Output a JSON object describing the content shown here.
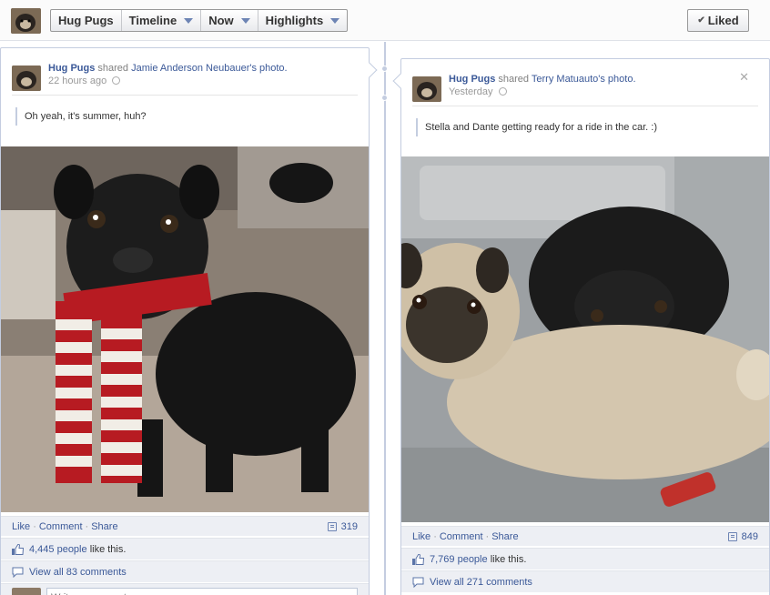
{
  "topbar": {
    "page_avatar": "hug-pugs-avatar",
    "nav": [
      {
        "label": "Hug Pugs",
        "caret": false
      },
      {
        "label": "Timeline",
        "caret": true
      },
      {
        "label": "Now",
        "caret": true
      },
      {
        "label": "Highlights",
        "caret": true
      }
    ],
    "liked_label": "Liked"
  },
  "colors": {
    "link": "#3b5998",
    "bar": "#edeff4",
    "border": "#c4cde0"
  },
  "posts": [
    {
      "author": "Hug Pugs",
      "shared_text": "shared",
      "source": "Jamie Anderson Neubauer's photo.",
      "time": "22 hours ago",
      "message": "Oh yeah, it's summer, huh?",
      "actions": {
        "like": "Like",
        "comment": "Comment",
        "share": "Share"
      },
      "comment_count": "319",
      "likes_count": "4,445 people",
      "likes_suffix": "like this.",
      "view_comments": "View all 83 comments",
      "comment_placeholder": "Write a comment...",
      "photo_subject": "black pug wearing red and white striped scarf"
    },
    {
      "author": "Hug Pugs",
      "shared_text": "shared",
      "source": "Terry Matuauto's photo.",
      "time": "Yesterday",
      "message": "Stella and Dante getting ready for a ride in the car. :)",
      "actions": {
        "like": "Like",
        "comment": "Comment",
        "share": "Share"
      },
      "comment_count": "849",
      "likes_count": "7,769 people",
      "likes_suffix": "like this.",
      "view_comments": "View all 271 comments",
      "photo_subject": "fawn pug and black pug in car seat"
    }
  ]
}
